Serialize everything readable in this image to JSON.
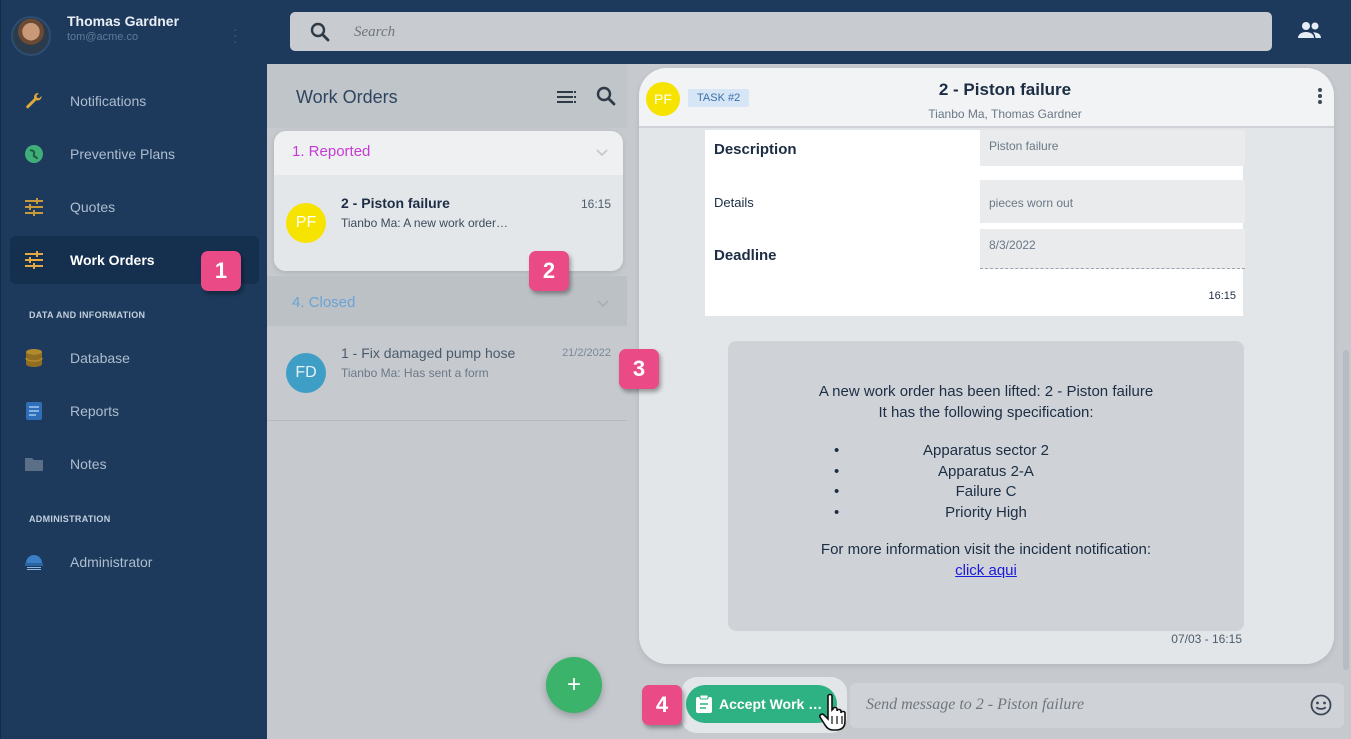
{
  "profile": {
    "name": "Thomas Gardner",
    "email": "tom@acme.co"
  },
  "sidebar": {
    "items": [
      {
        "label": "Notifications",
        "icon": "wrench-icon"
      },
      {
        "label": "Preventive Plans",
        "icon": "globe-icon"
      },
      {
        "label": "Quotes",
        "icon": "sliders-icon"
      },
      {
        "label": "Work Orders",
        "icon": "sliders-icon",
        "active": true
      },
      {
        "label": "Database",
        "icon": "database-icon"
      },
      {
        "label": "Reports",
        "icon": "report-icon"
      },
      {
        "label": "Notes",
        "icon": "folder-icon"
      },
      {
        "label": "Administrator",
        "icon": "admin-icon"
      }
    ],
    "sections": {
      "data": "DATA AND INFORMATION",
      "admin": "ADMINISTRATION"
    }
  },
  "search": {
    "placeholder": "Search"
  },
  "work_orders": {
    "title": "Work Orders",
    "groups": [
      {
        "label": "1. Reported",
        "items": [
          {
            "avatar": "PF",
            "title": "2 - Piston failure",
            "time": "16:15",
            "subtitle": "Tianbo Ma: A new work order…"
          }
        ]
      },
      {
        "label": "4. Closed",
        "items": [
          {
            "avatar": "FD",
            "title": "1 - Fix damaged pump hose",
            "time": "21/2/2022",
            "subtitle": "Tianbo Ma: Has sent a form"
          }
        ]
      }
    ],
    "fab_label": "+"
  },
  "chat": {
    "avatar": "PF",
    "badge": "TASK #2",
    "title": "2 - Piston failure",
    "participants": "Tianbo Ma, Thomas Gardner",
    "form": {
      "fields": [
        {
          "label": "Description",
          "value": "Piston failure"
        },
        {
          "label": "Details",
          "value": "pieces worn out"
        },
        {
          "label": "Deadline",
          "value": "8/3/2022"
        }
      ],
      "time": "16:15"
    },
    "notification": {
      "line1": "A new work order has been lifted: 2 -  Piston failure",
      "line2": "It has the following specification:",
      "bullets": [
        "Apparatus sector 2",
        "Apparatus 2-A",
        "Failure C",
        "Priority High"
      ],
      "line3": "For more information visit the incident notification:",
      "link": " click aqui ",
      "time": "07/03 - 16:15"
    },
    "accept_label": "Accept Work Order",
    "input_placeholder": "Send message to 2 - Piston failure"
  },
  "markers": [
    "1",
    "2",
    "3",
    "4"
  ],
  "colors": {
    "sidebar": "#1d3a5c",
    "accent_green": "#2fb283",
    "marker": "#ea4a86",
    "reported": "#c43bd3",
    "closed": "#6aa3d6"
  }
}
